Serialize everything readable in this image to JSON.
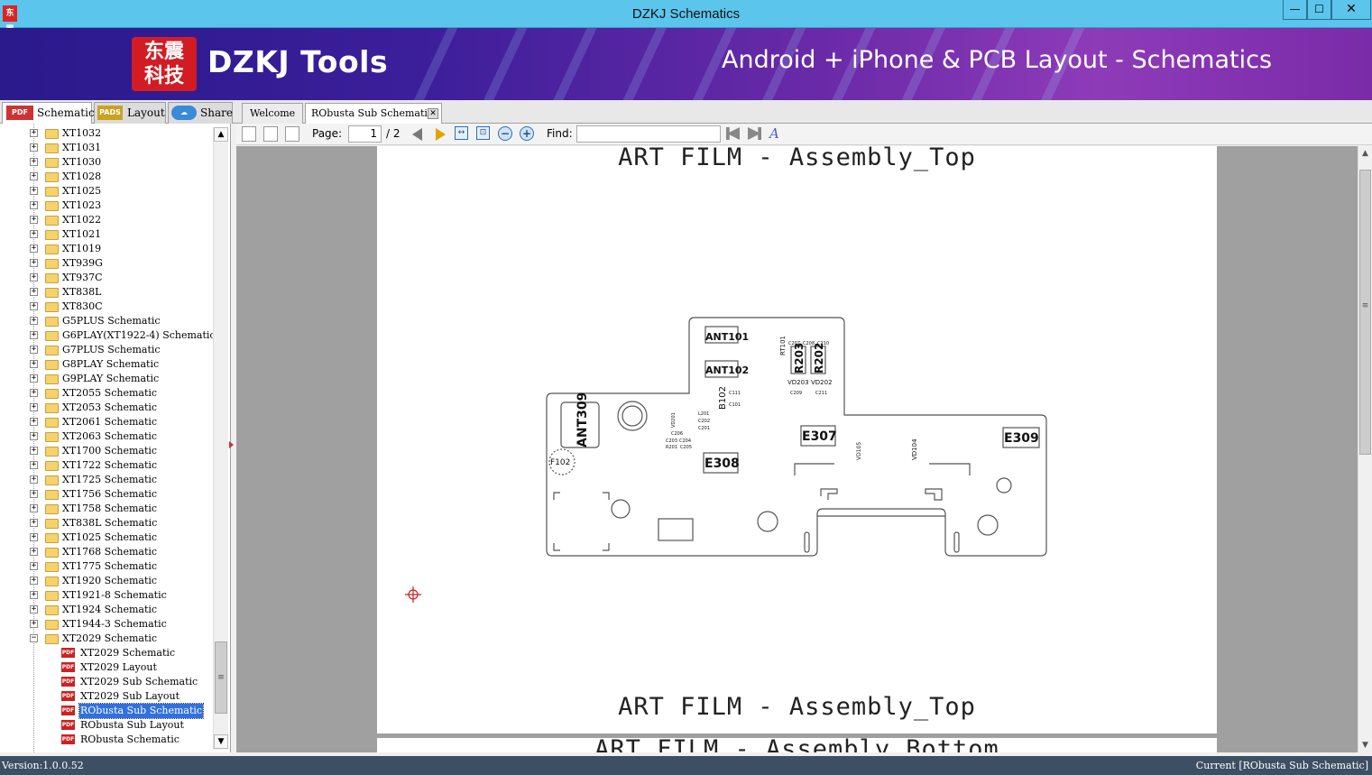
{
  "window": {
    "title": "DZKJ Schematics",
    "app_icon": "app-logo-icon",
    "app_icon_text": "东震",
    "min_glyph": "—",
    "max_glyph": "☐",
    "close_glyph": "✕"
  },
  "banner": {
    "logo_text": "东震\n科技",
    "brand": "DZKJ Tools",
    "tagline": "Android + iPhone & PCB Layout - Schematics",
    "colors": {
      "left": "#2a1a8c",
      "right": "#8e3bb8"
    }
  },
  "left_tabs": [
    {
      "icon_text": "PDF",
      "label": "Schematic",
      "active": true
    },
    {
      "icon_text": "PADS",
      "label": "Layout",
      "active": false
    },
    {
      "icon_text": "☁",
      "label": "Share",
      "active": false
    }
  ],
  "tree": {
    "folders": [
      "XT1032",
      "XT1031",
      "XT1030",
      "XT1028",
      "XT1025",
      "XT1023",
      "XT1022",
      "XT1021",
      "XT1019",
      "XT939G",
      "XT937C",
      "XT838L",
      "XT830C",
      "G5PLUS Schematic",
      "G6PLAY(XT1922-4) Schematic",
      "G7PLUS Schematic",
      "G8PLAY Schematic",
      "G9PLAY Schematic",
      "XT2055 Schematic",
      "XT2053 Schematic",
      "XT2061 Schematic",
      "XT2063 Schematic",
      "XT1700 Schematic",
      "XT1722 Schematic",
      "XT1725 Schematic",
      "XT1756 Schematic",
      "XT1758 Schematic",
      "XT838L Schematic",
      "XT1025 Schematic",
      "XT1768 Schematic",
      "XT1775 Schematic",
      "XT1920 Schematic",
      "XT1921-8 Schematic",
      "XT1924 Schematic",
      "XT1944-3 Schematic"
    ],
    "expanded_folder": "XT2029 Schematic",
    "children": [
      {
        "label": "XT2029 Schematic",
        "selected": false
      },
      {
        "label": "XT2029 Layout",
        "selected": false
      },
      {
        "label": "XT2029 Sub Schematic",
        "selected": false
      },
      {
        "label": "XT2029 Sub Layout",
        "selected": false
      },
      {
        "label": "RObusta Sub Schematic",
        "selected": true
      },
      {
        "label": "RObusta Sub Layout",
        "selected": false
      },
      {
        "label": "RObusta Schematic",
        "selected": false
      }
    ],
    "expand_glyph": "+",
    "collapse_glyph": "−",
    "pdf_icon_text": "PDF"
  },
  "doc_tabs": [
    {
      "label": "Welcome",
      "active": false
    },
    {
      "label": "RObusta Sub Schematic",
      "active": true,
      "close_glyph": "✕"
    }
  ],
  "toolbar": {
    "page_label": "Page:",
    "page_current": "1",
    "page_total": "/ 2",
    "find_label": "Find:",
    "find_value": "",
    "fit_width_glyph": "↔",
    "fit_page_glyph": "⊡",
    "zoom_out_glyph": "−",
    "zoom_in_glyph": "+",
    "highlight_glyph": "A"
  },
  "document": {
    "page1_title_top": "ART FILM - Assembly_Top",
    "page1_title_bottom": "ART FILM - Assembly_Top",
    "page2_title": "ART FILM - Assembly_Bottom",
    "components": {
      "ant309": "ANT309",
      "ant101": "ANT101",
      "ant102": "ANT102",
      "e307": "E307",
      "e308": "E308",
      "e309": "E309",
      "f102": "F102",
      "r203": "R203",
      "r202": "R202",
      "b102": "B102",
      "rt101": "RT101",
      "vd203": "VD203",
      "vd202": "VD202",
      "vd104": "VD104",
      "vd105": "VD105",
      "c207": "C207",
      "c208": "C208",
      "c210": "C210",
      "c209": "C209",
      "c211": "C211",
      "c111": "C111",
      "c101": "C101",
      "l201": "L201",
      "c202": "C202",
      "c201": "C201",
      "c204": "C204",
      "c205": "C205",
      "c203": "C203",
      "r201": "R201",
      "vd201": "VD201",
      "c206": "C206"
    }
  },
  "statusbar": {
    "version": "Version:1.0.0.52",
    "current": "Current [RObusta Sub Schematic]"
  }
}
